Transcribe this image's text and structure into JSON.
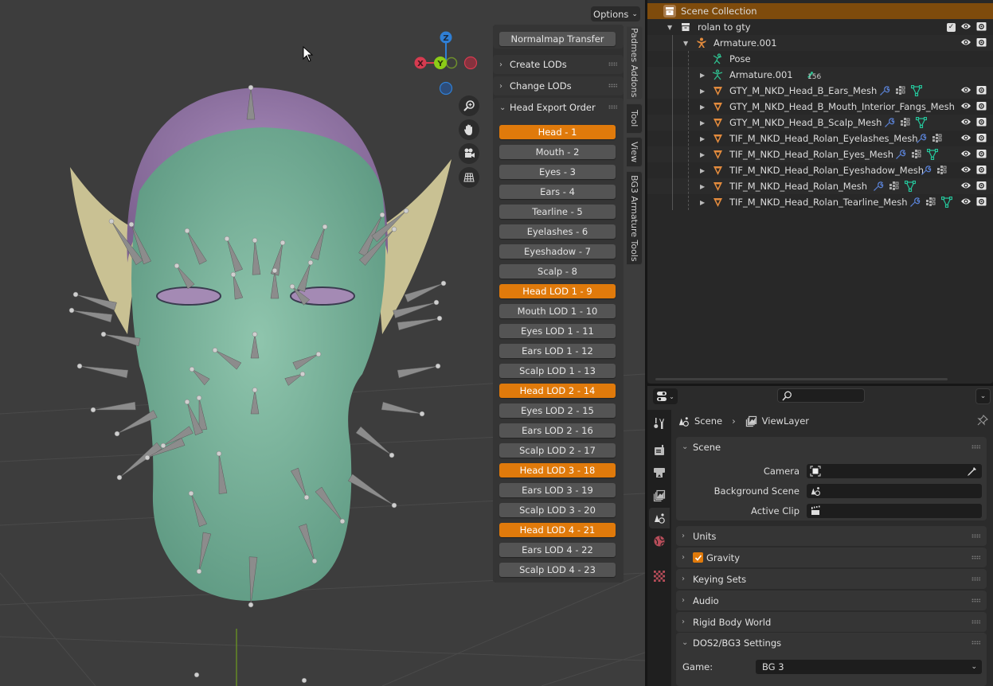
{
  "viewport": {
    "options_label": "Options",
    "gizmo": {
      "z_label": "Z",
      "y_label": "Y",
      "x_label": "X",
      "colors": {
        "x": "#d63b50",
        "y": "#8ccc17",
        "z": "#2f7fd5"
      }
    },
    "nav_buttons": [
      "zoom-icon",
      "hand-pan-icon",
      "camera-icon",
      "grid-ortho-icon"
    ]
  },
  "npanel": {
    "normalmap_button": "Normalmap Transfer",
    "sections": [
      {
        "label": "Create LODs",
        "expanded": false
      },
      {
        "label": "Change LODs",
        "expanded": false
      },
      {
        "label": "Head Export Order",
        "expanded": true
      }
    ],
    "export_order": [
      {
        "label": "Head - 1",
        "active": true
      },
      {
        "label": "Mouth - 2",
        "active": false
      },
      {
        "label": "Eyes - 3",
        "active": false
      },
      {
        "label": "Ears - 4",
        "active": false
      },
      {
        "label": "Tearline - 5",
        "active": false
      },
      {
        "label": "Eyelashes - 6",
        "active": false
      },
      {
        "label": "Eyeshadow - 7",
        "active": false
      },
      {
        "label": "Scalp - 8",
        "active": false
      },
      {
        "label": "Head LOD 1 - 9",
        "active": true
      },
      {
        "label": "Mouth LOD 1 - 10",
        "active": false
      },
      {
        "label": "Eyes LOD 1 - 11",
        "active": false
      },
      {
        "label": "Ears LOD 1 - 12",
        "active": false
      },
      {
        "label": "Scalp LOD 1 - 13",
        "active": false
      },
      {
        "label": "Head LOD 2 - 14",
        "active": true
      },
      {
        "label": "Eyes LOD 2 - 15",
        "active": false
      },
      {
        "label": "Ears LOD 2 - 16",
        "active": false
      },
      {
        "label": "Scalp LOD 2 - 17",
        "active": false
      },
      {
        "label": "Head LOD 3 - 18",
        "active": true
      },
      {
        "label": "Ears LOD 3 - 19",
        "active": false
      },
      {
        "label": "Scalp LOD 3 - 20",
        "active": false
      },
      {
        "label": "Head LOD 4 - 21",
        "active": true
      },
      {
        "label": "Ears LOD 4 - 22",
        "active": false
      },
      {
        "label": "Scalp LOD 4 - 23",
        "active": false
      }
    ],
    "tabs": [
      {
        "label": "Padmes Addons",
        "active": true
      },
      {
        "label": "Tool",
        "active": false
      },
      {
        "label": "View",
        "active": false
      },
      {
        "label": "BG3 Armature Tools",
        "active": false
      }
    ]
  },
  "outliner": {
    "scene_collection": "Scene Collection",
    "collection": "rolan to gty",
    "armature": "Armature.001",
    "pose": "Pose",
    "armature_data": "Armature.001",
    "bone_count": "156",
    "meshes": [
      {
        "name": "GTY_M_NKD_Head_B_Ears_Mesh",
        "icons": [
          "wrench",
          "modifiers",
          "mesh-data"
        ]
      },
      {
        "name": "GTY_M_NKD_Head_B_Mouth_Interior_Fangs_Mesh",
        "icons": []
      },
      {
        "name": "GTY_M_NKD_Head_B_Scalp_Mesh",
        "icons": [
          "wrench",
          "modifiers",
          "mesh-data"
        ]
      },
      {
        "name": "TIF_M_NKD_Head_Rolan_Eyelashes_Mesh",
        "icons": [
          "wrench",
          "modifiers"
        ]
      },
      {
        "name": "TIF_M_NKD_Head_Rolan_Eyes_Mesh",
        "icons": [
          "wrench",
          "modifiers",
          "mesh-data"
        ]
      },
      {
        "name": "TIF_M_NKD_Head_Rolan_Eyeshadow_Mesh",
        "icons": [
          "wrench",
          "modifiers"
        ]
      },
      {
        "name": "TIF_M_NKD_Head_Rolan_Mesh",
        "icons": [
          "wrench",
          "modifiers",
          "mesh-data"
        ]
      },
      {
        "name": "TIF_M_NKD_Head_Rolan_Tearline_Mesh",
        "icons": [
          "wrench",
          "modifiers",
          "mesh-data"
        ]
      }
    ]
  },
  "properties": {
    "search_placeholder": "",
    "breadcrumb": {
      "scene": "Scene",
      "view_layer": "ViewLayer"
    },
    "scene_panel": {
      "title": "Scene",
      "camera_label": "Camera",
      "camera_value": "",
      "background_label": "Background Scene",
      "background_value": "",
      "clip_label": "Active Clip",
      "clip_value": ""
    },
    "collapsed_panels": [
      "Units",
      "Gravity",
      "Keying Sets",
      "Audio",
      "Rigid Body World"
    ],
    "gravity_enabled": true,
    "dos2_panel": {
      "title": "DOS2/BG3 Settings",
      "game_label": "Game:",
      "game_value": "BG 3"
    },
    "tabs": [
      "tool",
      "render",
      "output",
      "view-layer",
      "scene",
      "world",
      "texture"
    ],
    "active_tab": "scene"
  },
  "colors": {
    "accent": "#e07a0b",
    "selected_row": "#7e4b0c",
    "mesh_icon": "#e38b3d",
    "armature_icon": "#2fbf8f"
  }
}
